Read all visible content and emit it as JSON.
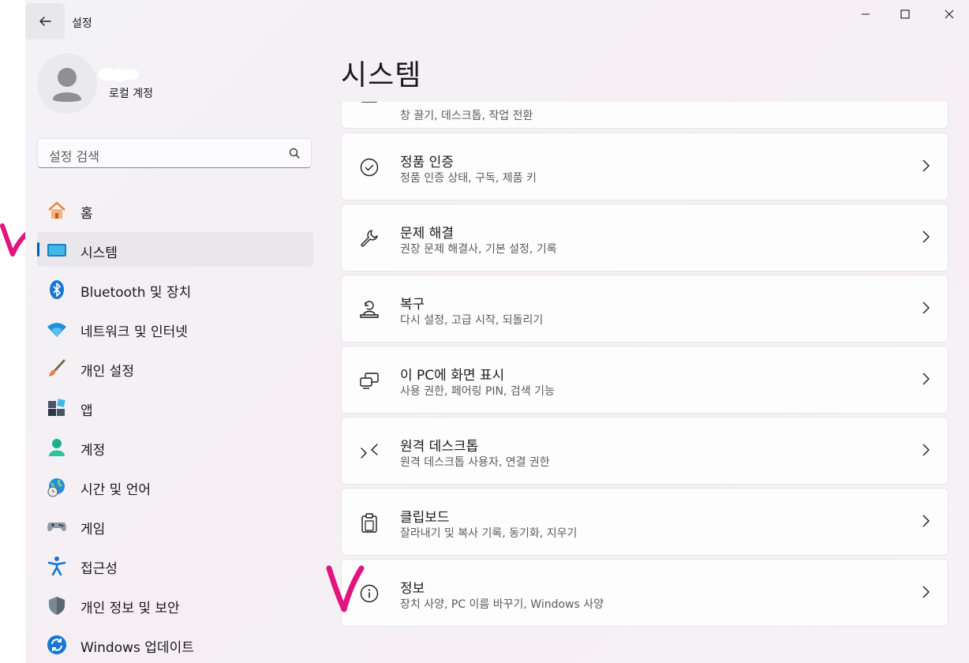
{
  "app": {
    "title": "설정"
  },
  "profile": {
    "account_type": "로컬 계정"
  },
  "search": {
    "placeholder": "설정 검색"
  },
  "nav": {
    "items": [
      {
        "label": "홈",
        "icon": "home-icon",
        "selected": false
      },
      {
        "label": "시스템",
        "icon": "system-icon",
        "selected": true
      },
      {
        "label": "Bluetooth 및 장치",
        "icon": "bluetooth-icon",
        "selected": false
      },
      {
        "label": "네트워크 및 인터넷",
        "icon": "wifi-icon",
        "selected": false
      },
      {
        "label": "개인 설정",
        "icon": "paintbrush-icon",
        "selected": false
      },
      {
        "label": "앱",
        "icon": "apps-icon",
        "selected": false
      },
      {
        "label": "계정",
        "icon": "account-icon",
        "selected": false
      },
      {
        "label": "시간 및 언어",
        "icon": "globe-clock-icon",
        "selected": false
      },
      {
        "label": "게임",
        "icon": "gamepad-icon",
        "selected": false
      },
      {
        "label": "접근성",
        "icon": "accessibility-icon",
        "selected": false
      },
      {
        "label": "개인 정보 및 보안",
        "icon": "shield-icon",
        "selected": false
      },
      {
        "label": "Windows 업데이트",
        "icon": "update-icon",
        "selected": false
      }
    ]
  },
  "main": {
    "title": "시스템",
    "partial_card": {
      "subtitle": "창 끌기, 데스크톱, 작업 전환"
    },
    "cards": [
      {
        "title": "정품 인증",
        "subtitle": "정품 인증 상태, 구독, 제품 키",
        "icon": "checkmark-circle-icon"
      },
      {
        "title": "문제 해결",
        "subtitle": "권장 문제 해결사, 기본 설정, 기록",
        "icon": "wrench-icon"
      },
      {
        "title": "복구",
        "subtitle": "다시 설정, 고급 시작, 되돌리기",
        "icon": "recovery-icon"
      },
      {
        "title": "이 PC에 화면 표시",
        "subtitle": "사용 권한, 페어링 PIN, 검색 기능",
        "icon": "project-screen-icon"
      },
      {
        "title": "원격 데스크톱",
        "subtitle": "원격 데스크톱 사용자, 연결 권한",
        "icon": "remote-desktop-icon"
      },
      {
        "title": "클립보드",
        "subtitle": "잘라내기 및 복사 기록, 동기화, 지우기",
        "icon": "clipboard-icon"
      },
      {
        "title": "정보",
        "subtitle": "장치 사양, PC 이름 바꾸기, Windows 사양",
        "icon": "info-icon"
      }
    ]
  },
  "colors": {
    "accent": "#005fb8",
    "annotation": "#e0157f"
  }
}
